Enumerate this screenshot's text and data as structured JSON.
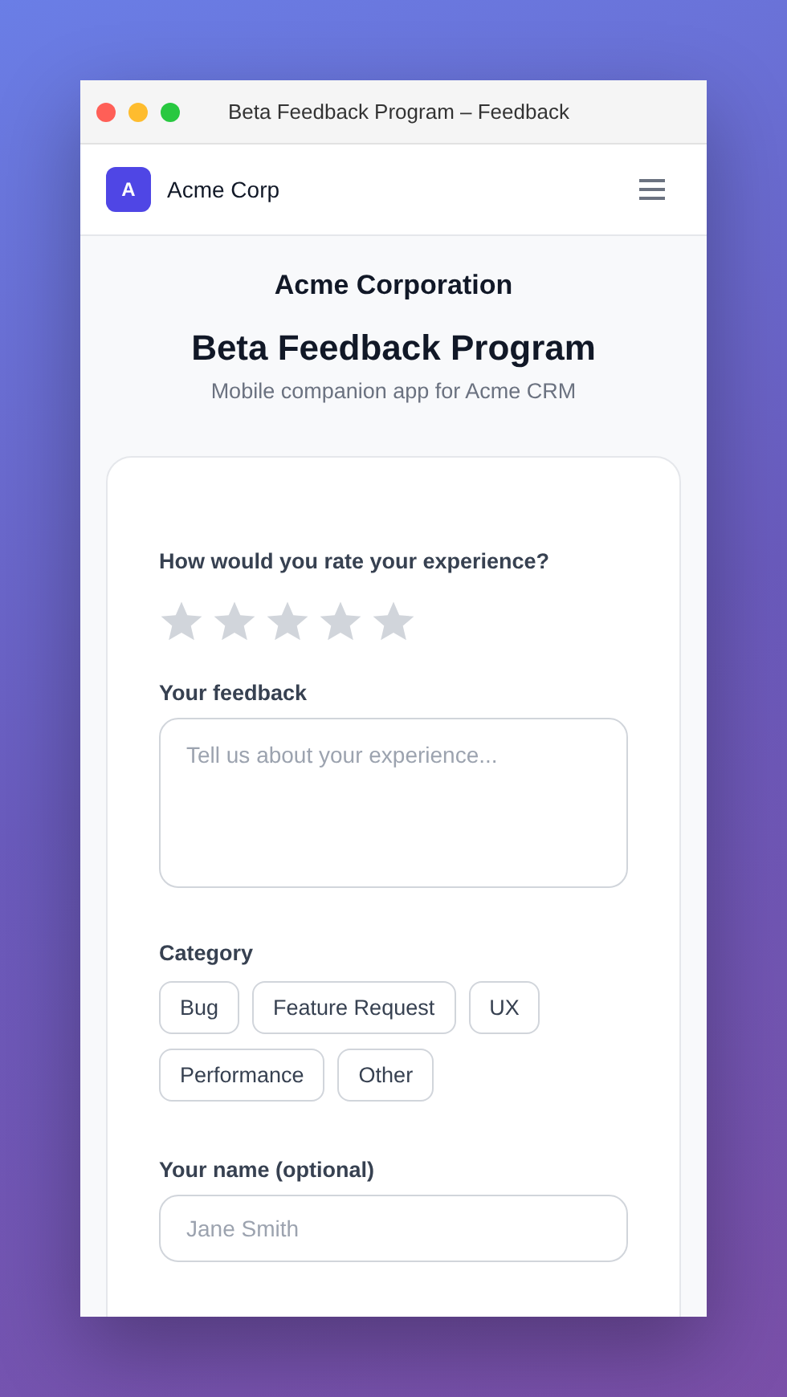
{
  "window": {
    "title": "Beta Feedback Program – Feedback"
  },
  "app_bar": {
    "logo_letter": "A",
    "brand": "Acme Corp"
  },
  "header": {
    "organization": "Acme Corporation",
    "title": "Beta Feedback Program",
    "subtitle": "Mobile companion app for Acme CRM"
  },
  "form": {
    "rating": {
      "label": "How would you rate your experience?",
      "stars": 0
    },
    "feedback": {
      "label": "Your feedback",
      "placeholder": "Tell us about your experience..."
    },
    "category": {
      "label": "Category",
      "options": [
        {
          "label": "Bug",
          "selected": false
        },
        {
          "label": "Feature Request",
          "selected": false
        },
        {
          "label": "UX",
          "selected": false
        },
        {
          "label": "Performance",
          "selected": false
        },
        {
          "label": "Other",
          "selected": false
        }
      ]
    },
    "name": {
      "label": "Your name (optional)",
      "placeholder": "Jane Smith"
    }
  }
}
